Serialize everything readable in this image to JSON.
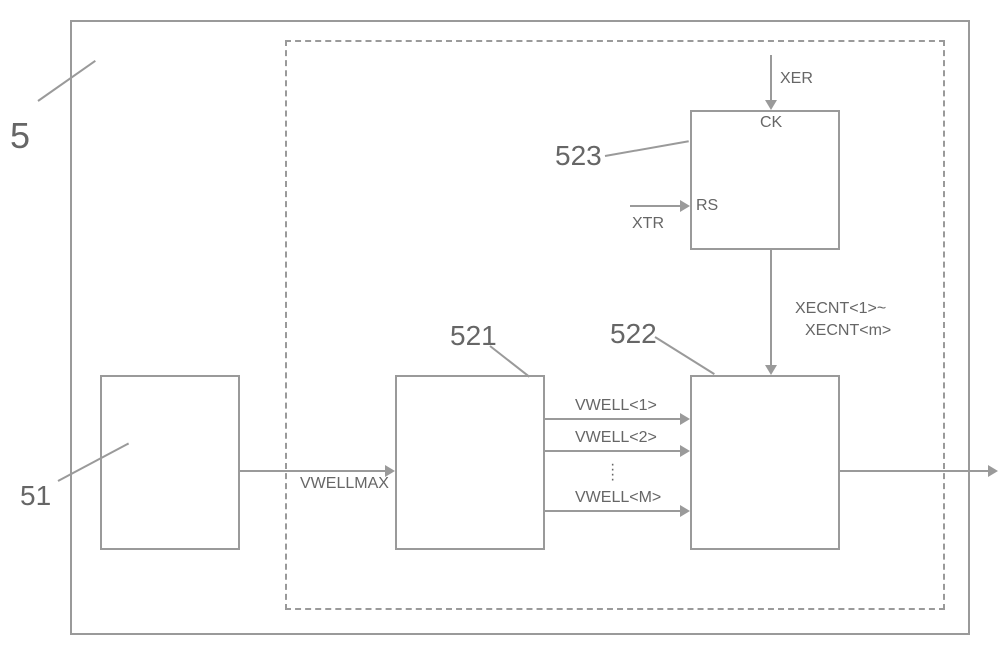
{
  "outer_label": "5",
  "block51": {
    "label": "51"
  },
  "block521": {
    "label": "521"
  },
  "block522": {
    "label": "522"
  },
  "block523": {
    "label": "523",
    "port_ck": "CK",
    "port_rs": "RS"
  },
  "signals": {
    "xer": "XER",
    "xtr": "XTR",
    "vwellmax": "VWELLMAX",
    "vwell1": "VWELL<1>",
    "vwell2": "VWELL<2>",
    "vwellM": "VWELL<M>",
    "xecnt_top": "XECNT<1>~",
    "xecnt_bot": "XECNT<m>"
  }
}
